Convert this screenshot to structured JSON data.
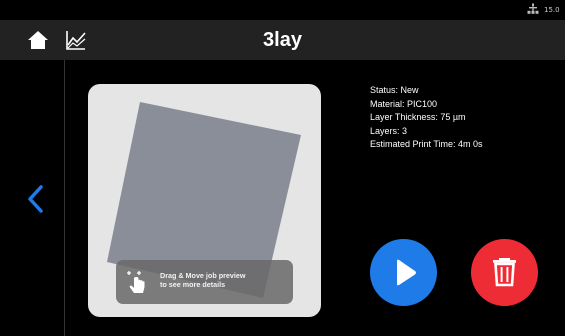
{
  "status_bar": {
    "network_icon": "network-icon",
    "text": "15.0"
  },
  "header": {
    "title": "3lay",
    "home_icon": "home-icon",
    "graph_icon": "chart-line-icon"
  },
  "navigation": {
    "back_icon": "chevron-left-icon"
  },
  "preview": {
    "hint_line1": "Drag & Move job preview",
    "hint_line2": "to see more details",
    "hint_icon": "hand-drag-icon"
  },
  "job_info": {
    "status": "Status: New",
    "material": "Material: PIC100",
    "layer_thickness": "Layer Thickness: 75 µm",
    "layers": "Layers: 3",
    "estimated_time": "Estimated Print Time: 4m 0s"
  },
  "actions": {
    "play_icon": "play-icon",
    "delete_icon": "trash-icon"
  },
  "colors": {
    "header_bg": "#222222",
    "accent_blue": "#1e7be8",
    "danger_red": "#ee2c35",
    "preview_bg": "#e5e5e5",
    "shape_fill": "#8a8e99"
  }
}
